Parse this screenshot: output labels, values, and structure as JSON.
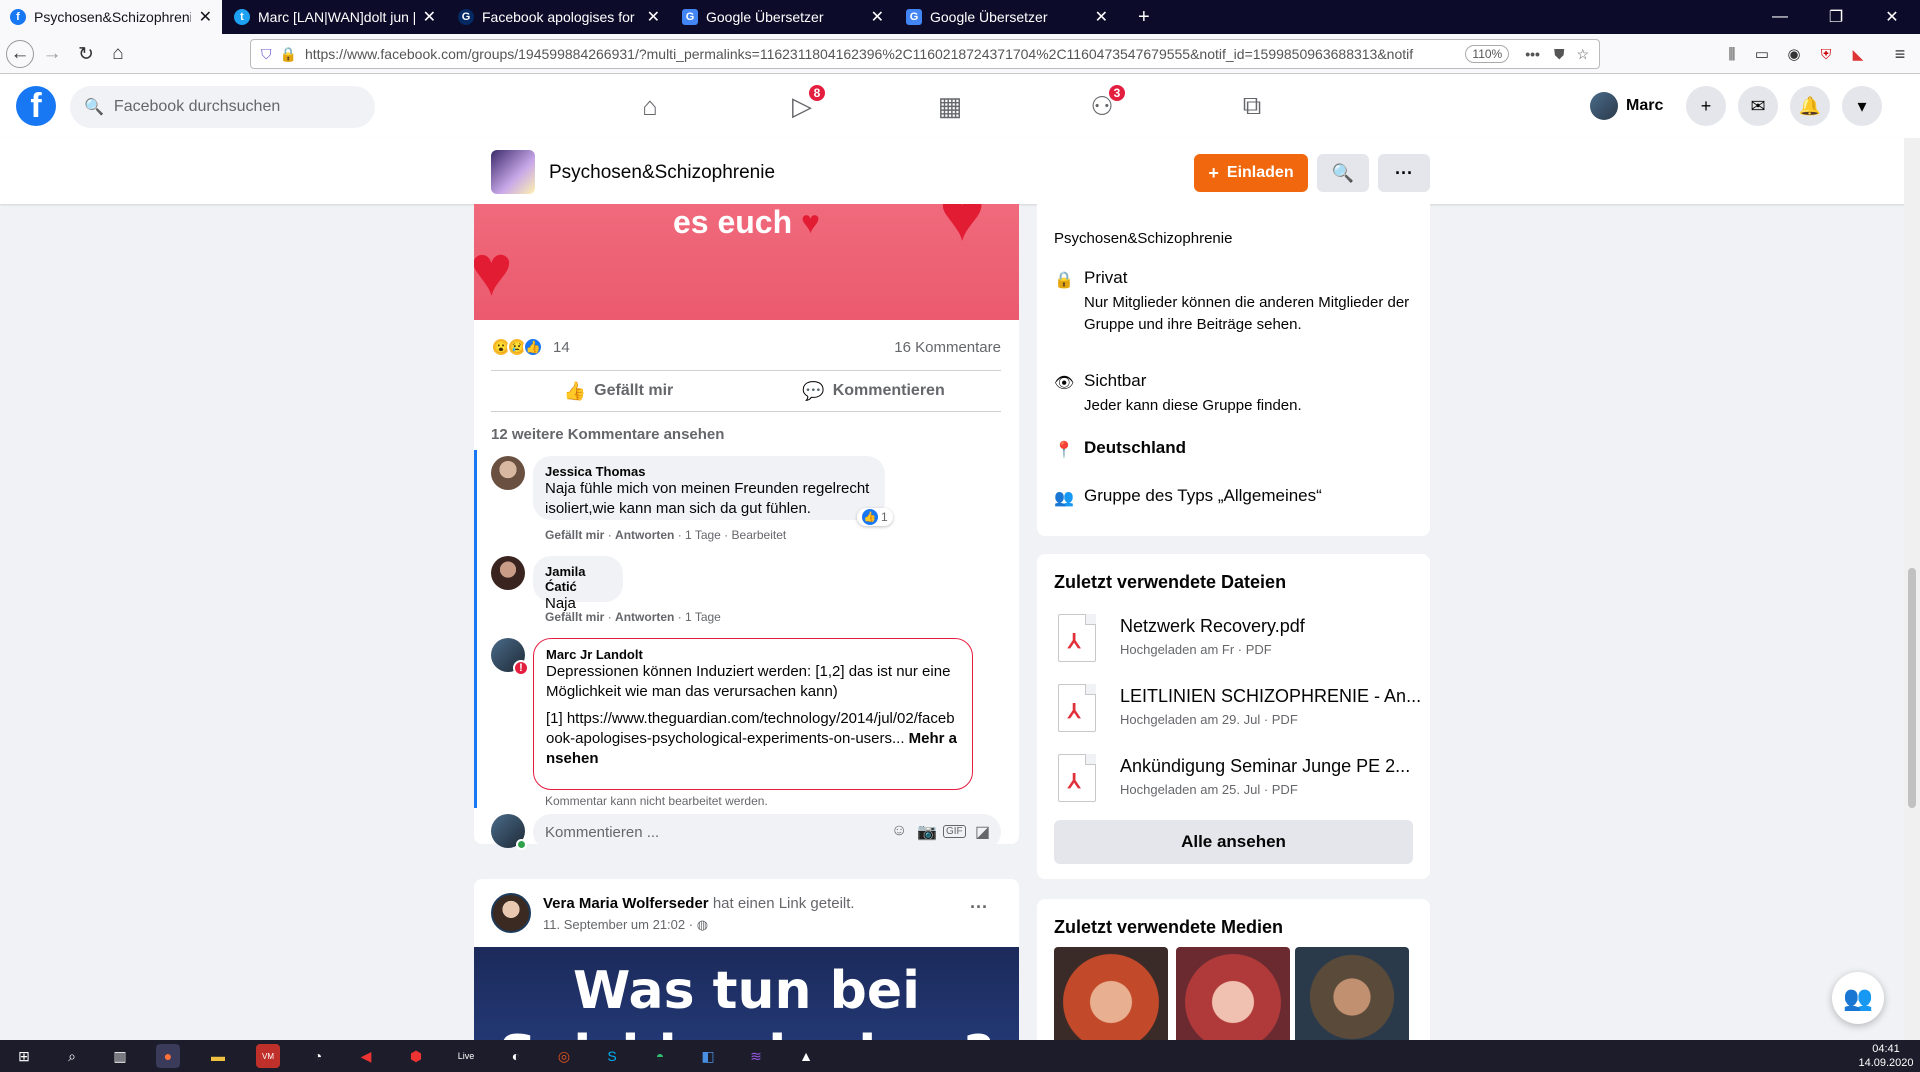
{
  "browser": {
    "tabs": [
      {
        "title": "Psychosen&Schizophrenie | Fa",
        "favicon": "facebook-icon",
        "color": "#1877f2",
        "active": true
      },
      {
        "title": "Marc [LAN|WAN]dolt jun [ملا",
        "favicon": "twitter-icon",
        "color": "#1da1f2",
        "active": false
      },
      {
        "title": "Facebook apologises for psych",
        "favicon": "guardian-icon",
        "color": "#052962",
        "active": false
      },
      {
        "title": "Google Übersetzer",
        "favicon": "google-translate-icon",
        "color": "#4285f4",
        "active": false
      },
      {
        "title": "Google Übersetzer",
        "favicon": "google-translate-icon",
        "color": "#4285f4",
        "active": false
      }
    ],
    "url": "https://www.facebook.com/groups/194599884266931/?multi_permalinks=1162311804162396%2C1160218724371704%2C1160473547679555&notif_id=1599850963688313&notif",
    "zoom": "110%"
  },
  "fb": {
    "search_placeholder": "Facebook durchsuchen",
    "watch_badge": "8",
    "groups_badge": "3",
    "user_name": "Marc"
  },
  "group": {
    "name": "Psychosen&Schizophrenie",
    "invite_label": "Einladen"
  },
  "post1": {
    "image_text": "es euch",
    "reaction_count": "14",
    "comment_count": "16 Kommentare",
    "like_label": "Gefällt mir",
    "comment_label": "Kommentieren",
    "more_comments": "12 weitere Kommentare ansehen",
    "comments": [
      {
        "author": "Jessica Thomas",
        "text": "Naja fühle mich von meinen Freunden regelrecht isoliert,wie kann man sich da gut fühlen.",
        "like": "Gefällt mir",
        "reply": "Antworten",
        "time": "1 Tage",
        "edited": "Bearbeitet",
        "reactions": "1"
      },
      {
        "author": "Jamila Ćatić",
        "text": "Naja",
        "like": "Gefällt mir",
        "reply": "Antworten",
        "time": "1 Tage"
      },
      {
        "author": "Marc Jr Landolt",
        "text": "Depressionen können Induziert werden: [1,2] das ist nur eine Möglichkeit wie man das verursachen kann)",
        "link_text": "[1] https://www.theguardian.com/technology/2014/jul/02/facebook-apologises-psychological-experiments-on-users...",
        "more": "Mehr ansehen",
        "note": "Kommentar kann nicht bearbeitet werden."
      }
    ],
    "input_placeholder": "Kommentieren ..."
  },
  "post2": {
    "author": "Vera Maria Wolferseder",
    "action": "hat einen Link geteilt.",
    "date": "11. September um 21:02 · ",
    "image_line1": "Was tun bei",
    "image_line2": "Suizidgedanken?"
  },
  "about": {
    "description": "Psychosen&Schizophrenie",
    "privacy_title": "Privat",
    "privacy_text": "Nur Mitglieder können die anderen Mitglieder der Gruppe und ihre Beiträge sehen.",
    "visible_title": "Sichtbar",
    "visible_text": "Jeder kann diese Gruppe finden.",
    "location": "Deutschland",
    "type": "Gruppe des Typs „Allgemeines“"
  },
  "files": {
    "title": "Zuletzt verwendete Dateien",
    "items": [
      {
        "name": "Netzwerk Recovery.pdf",
        "meta": "Hochgeladen am Fr · PDF"
      },
      {
        "name": "LEITLINIEN SCHIZOPHRENIE - An...",
        "meta": "Hochgeladen am 29. Jul · PDF"
      },
      {
        "name": "Ankündigung Seminar Junge PE 2...",
        "meta": "Hochgeladen am 25. Jul · PDF"
      }
    ],
    "see_all": "Alle ansehen"
  },
  "media": {
    "title": "Zuletzt verwendete Medien"
  },
  "taskbar": {
    "time": "04:41",
    "date": "14.09.2020"
  }
}
